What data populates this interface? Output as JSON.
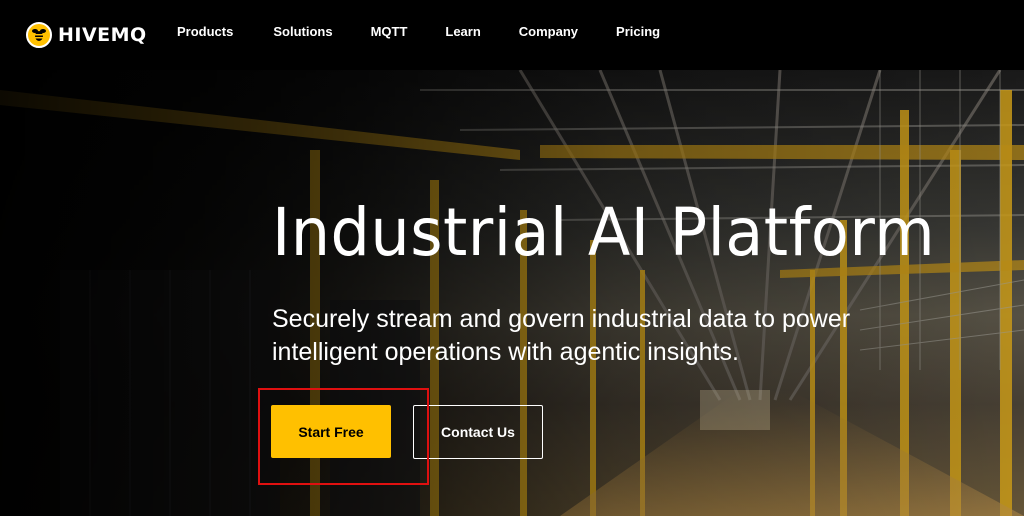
{
  "brand": {
    "name": "HIVEMQ",
    "accent": "#ffc000"
  },
  "nav": {
    "items": [
      {
        "label": "Products"
      },
      {
        "label": "Solutions"
      },
      {
        "label": "MQTT"
      },
      {
        "label": "Learn"
      },
      {
        "label": "Company"
      },
      {
        "label": "Pricing"
      }
    ]
  },
  "hero": {
    "title": "Industrial AI Platform",
    "subtitle_line1": "Securely stream and govern industrial data to power",
    "subtitle_line2": "intelligent operations with agentic insights.",
    "primary_cta": "Start Free",
    "secondary_cta": "Contact Us"
  }
}
